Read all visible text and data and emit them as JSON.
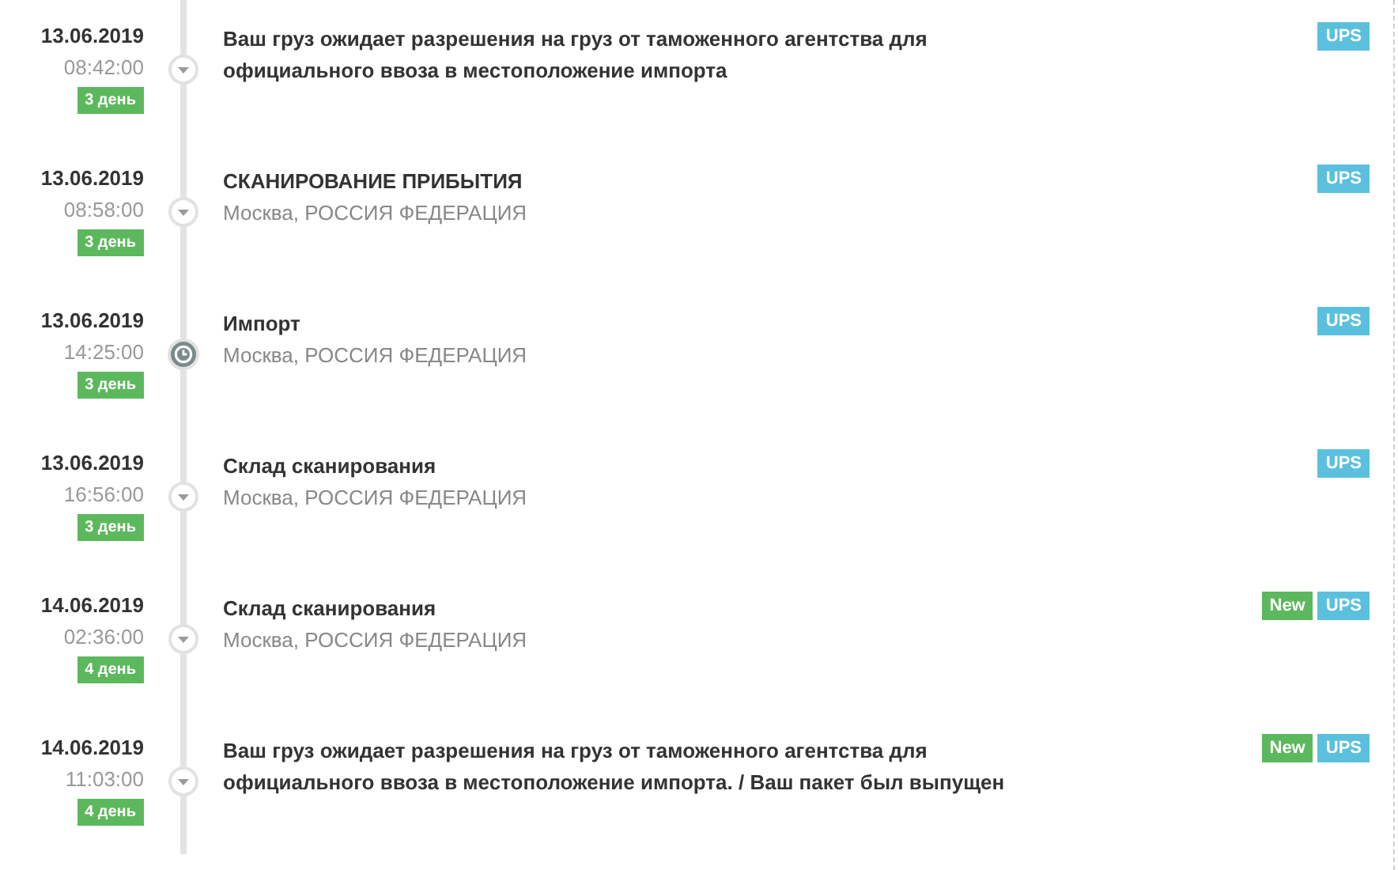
{
  "events": [
    {
      "date": "13.06.2019",
      "time": "08:42:00",
      "day": "3 день",
      "kind": "arrow",
      "title": "Ваш груз ожидает разрешения на груз от таможенного агентства для официального ввоза в местоположение импорта",
      "tags": [
        {
          "label": "UPS",
          "color": "#5bc0de"
        }
      ]
    },
    {
      "date": "13.06.2019",
      "time": "08:58:00",
      "day": "3 день",
      "kind": "arrow",
      "title": "СКАНИРОВАНИЕ ПРИБЫТИЯ",
      "location": "Москва, РОССИЯ ФЕДЕРАЦИЯ",
      "tags": [
        {
          "label": "UPS",
          "color": "#5bc0de"
        }
      ]
    },
    {
      "date": "13.06.2019",
      "time": "14:25:00",
      "day": "3 день",
      "kind": "clock",
      "title": "Импорт",
      "location": "Москва, РОССИЯ ФЕДЕРАЦИЯ",
      "tags": [
        {
          "label": "UPS",
          "color": "#5bc0de"
        }
      ]
    },
    {
      "date": "13.06.2019",
      "time": "16:56:00",
      "day": "3 день",
      "kind": "arrow",
      "title": "Склад сканирования",
      "location": "Москва, РОССИЯ ФЕДЕРАЦИЯ",
      "tags": [
        {
          "label": "UPS",
          "color": "#5bc0de"
        }
      ]
    },
    {
      "date": "14.06.2019",
      "time": "02:36:00",
      "day": "4 день",
      "kind": "arrow",
      "title": "Склад сканирования",
      "location": "Москва, РОССИЯ ФЕДЕРАЦИЯ",
      "tags": [
        {
          "label": "New",
          "color": "#5cb85c"
        },
        {
          "label": "UPS",
          "color": "#5bc0de"
        }
      ]
    },
    {
      "date": "14.06.2019",
      "time": "11:03:00",
      "day": "4 день",
      "kind": "arrow",
      "title": "Ваш груз ожидает разрешения на груз от таможенного агентства для официального ввоза в местоположение импорта. / Ваш пакет был выпущен",
      "tags": [
        {
          "label": "New",
          "color": "#5cb85c"
        },
        {
          "label": "UPS",
          "color": "#5bc0de"
        }
      ]
    }
  ]
}
